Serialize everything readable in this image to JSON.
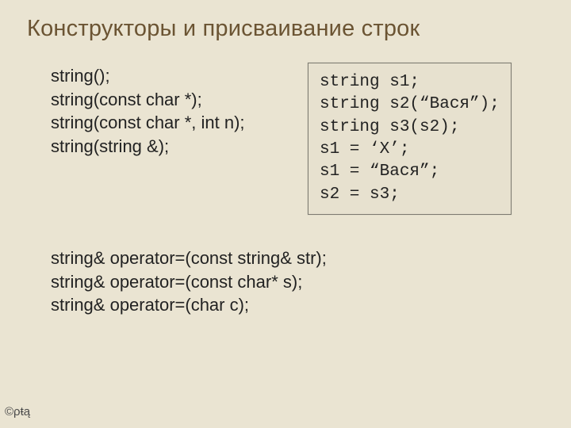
{
  "title": "Конструкторы и присваивание строк",
  "constructors": {
    "l1": "string();",
    "l2": "string(const char *);",
    "l3": "string(const char *, int n);",
    "l4": "string(string &);"
  },
  "code": {
    "l1": "string s1;",
    "l2": "string s2(“Вася”);",
    "l3": "string s3(s2);",
    "l4": "s1 = ‘X’;",
    "l5": "s1 = “Вася”;",
    "l6": "s2 = s3;"
  },
  "operators": {
    "l1": "string& operator=(const string& str);",
    "l2": "string& operator=(const char* s);",
    "l3": "string& operator=(char c);"
  },
  "footer": "©ρŧą"
}
